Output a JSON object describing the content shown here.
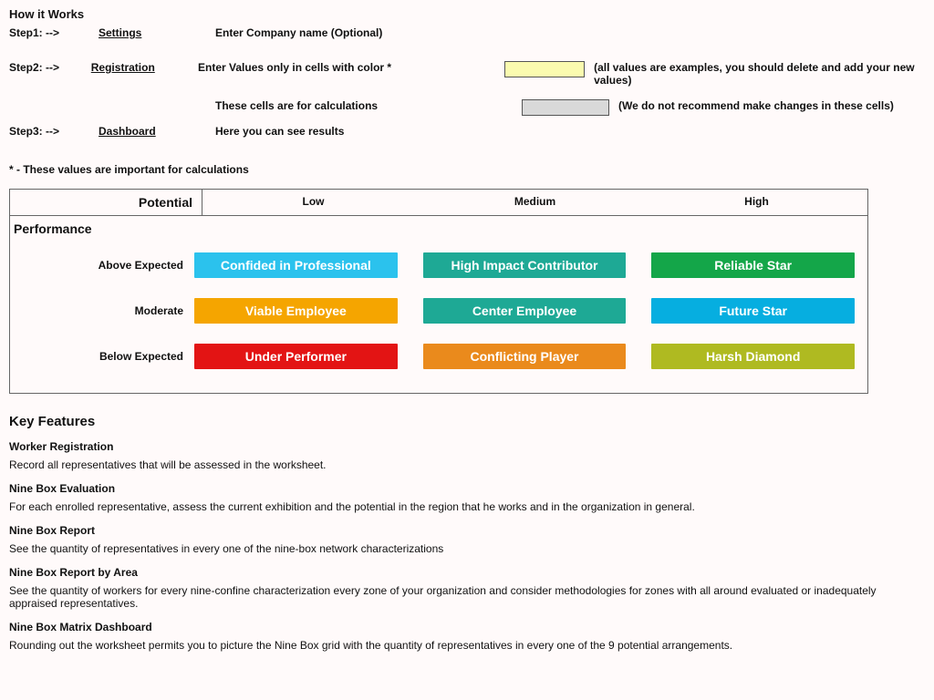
{
  "title": "How it Works",
  "steps": [
    {
      "name": "Step1: -->",
      "link": "Settings",
      "desc": "Enter Company name (Optional)"
    },
    {
      "name": "Step2: -->",
      "link": "Registration",
      "desc1": "Enter Values only in cells with color *",
      "desc2": "These cells are for calculations",
      "note1": "(all values are examples, you should delete and add your new values)",
      "note2": "(We do not recommend make changes in these cells)"
    },
    {
      "name": "Step3: -->",
      "link": "Dashboard",
      "desc": "Here you can see results"
    }
  ],
  "footnote": "* - These values are important for calculations",
  "matrix": {
    "xlabel": "Potential",
    "ylabel": "Performance",
    "cols": [
      "Low",
      "Medium",
      "High"
    ],
    "rows": [
      "Above Expected",
      "Moderate",
      "Below Expected"
    ],
    "cells": [
      [
        "Confided in Professional",
        "High Impact Contributor",
        "Reliable Star"
      ],
      [
        "Viable Employee",
        "Center Employee",
        "Future Star"
      ],
      [
        "Under Performer",
        "Conflicting Player",
        "Harsh Diamond"
      ]
    ]
  },
  "key_features": {
    "title": "Key Features",
    "items": [
      {
        "h": "Worker Registration",
        "p": "Record all representatives that will be assessed in the worksheet."
      },
      {
        "h": "Nine Box Evaluation",
        "p": "For each enrolled representative, assess the current exhibition and the potential in the region that he works and in the organization in general."
      },
      {
        "h": "Nine Box Report",
        "p": "See the quantity of representatives in every one of the nine-box network characterizations"
      },
      {
        "h": "Nine Box Report by Area",
        "p": "See the quantity of workers for every nine-confine characterization every zone of your organization and consider methodologies for zones with all around evaluated or inadequately appraised representatives."
      },
      {
        "h": "Nine Box Matrix Dashboard",
        "p": "Rounding out the worksheet permits you to picture the Nine Box grid with the quantity of representatives in every one of the 9 potential arrangements."
      }
    ]
  }
}
